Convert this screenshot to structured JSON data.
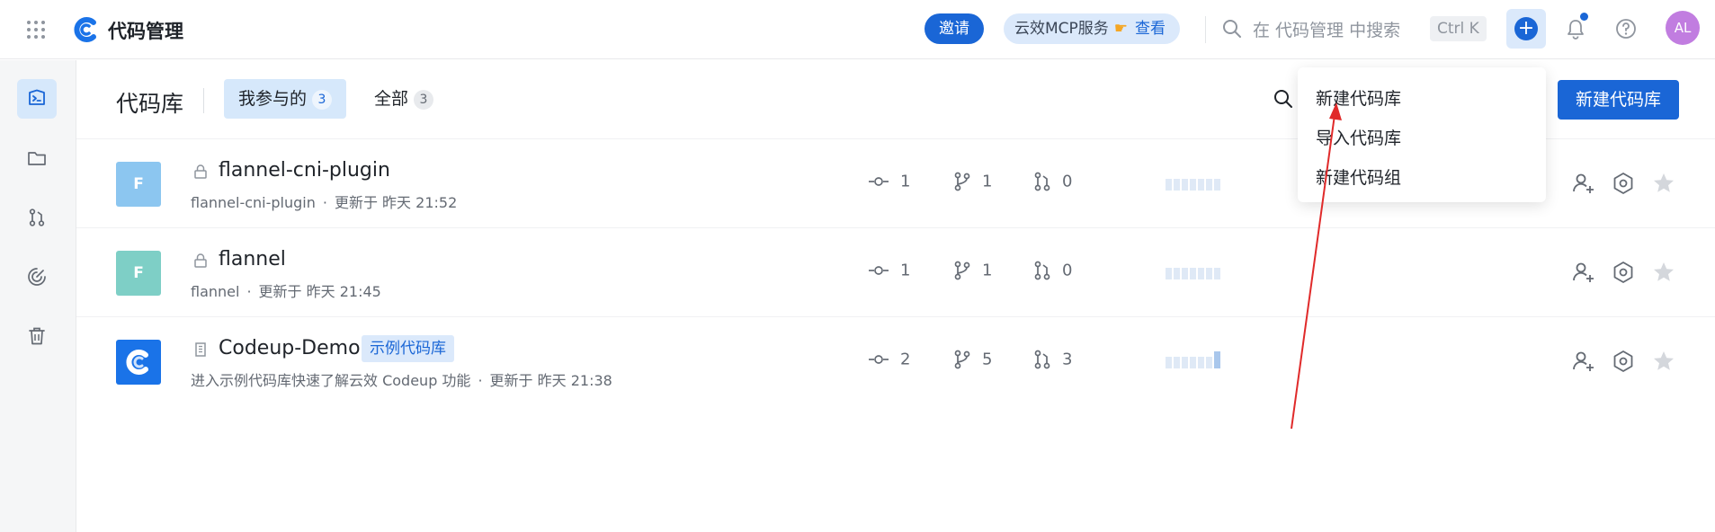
{
  "topbar": {
    "app_name": "代码管理",
    "invite_label": "邀请",
    "mcp_label": "云效MCP服务",
    "mcp_view_label": "查看",
    "search_placeholder": "在 代码管理 中搜索",
    "search_shortcut": "Ctrl K",
    "create_label": "+",
    "avatar_initials": "AL",
    "icons": [
      "apps-grid-icon",
      "codeup-logo",
      "search-icon",
      "plus-icon",
      "bell-icon",
      "help-icon"
    ]
  },
  "sidebar": {
    "items": [
      {
        "name": "repo-code-icon",
        "active": true
      },
      {
        "name": "folder-icon",
        "active": false
      },
      {
        "name": "merge-request-icon",
        "active": false
      },
      {
        "name": "target-icon",
        "active": false
      },
      {
        "name": "trash-icon",
        "active": false
      }
    ]
  },
  "header": {
    "title": "代码库",
    "tabs": [
      {
        "label": "我参与的",
        "count": "3",
        "active": true
      },
      {
        "label": "全部",
        "count": "3",
        "active": false
      }
    ],
    "new_repo_label": "新建代码库"
  },
  "dropdown": {
    "items": [
      "新建代码库",
      "导入代码库",
      "新建代码组"
    ]
  },
  "repos": [
    {
      "initial": "F",
      "avatar_color": "#8cc6f0",
      "visibility": "lock-icon",
      "name": "flannel-cni-plugin",
      "tag": "",
      "path": "flannel-cni-plugin",
      "separator": "·",
      "updated": "更新于 昨天 21:52",
      "commits": "1",
      "branches": "1",
      "merge_requests": "0",
      "activity": [
        0,
        0,
        0,
        0,
        0,
        0,
        0
      ]
    },
    {
      "initial": "F",
      "avatar_color": "#7ecfc6",
      "visibility": "lock-icon",
      "name": "flannel",
      "tag": "",
      "path": "flannel",
      "separator": "·",
      "updated": "更新于 昨天 21:45",
      "commits": "1",
      "branches": "1",
      "merge_requests": "0",
      "activity": [
        0,
        0,
        0,
        0,
        0,
        0,
        0
      ]
    },
    {
      "initial": "C",
      "avatar_color": "#1a73e8",
      "visibility": "building-icon",
      "name": "Codeup-Demo",
      "tag": "示例代码库",
      "path": "进入示例代码库快速了解云效 Codeup 功能",
      "separator": "·",
      "updated": "更新于 昨天 21:38",
      "commits": "2",
      "branches": "5",
      "merge_requests": "3",
      "activity": [
        0,
        0,
        0,
        0,
        0,
        0,
        1
      ]
    }
  ],
  "row_actions": [
    "add-member-icon",
    "settings-icon",
    "star-icon"
  ],
  "colors": {
    "accent": "#1a66d6",
    "accent_soft": "#d6e8fb",
    "annotation": "#e02a2a"
  }
}
